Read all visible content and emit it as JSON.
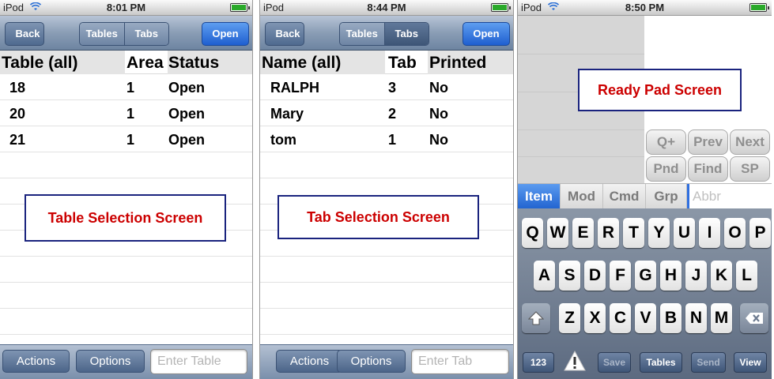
{
  "screen1": {
    "status": {
      "carrier": "iPod",
      "time": "8:01 PM"
    },
    "nav": {
      "back": "Back",
      "seg_left": "Tables",
      "seg_right": "Tabs",
      "open": "Open"
    },
    "headers": [
      "Table (all)",
      "Area",
      "Status"
    ],
    "rows": [
      {
        "c1": "18",
        "c2": "1",
        "c3": "Open"
      },
      {
        "c1": "20",
        "c2": "1",
        "c3": "Open"
      },
      {
        "c1": "21",
        "c2": "1",
        "c3": "Open"
      }
    ],
    "callout": "Table Selection Screen",
    "toolbar": {
      "actions": "Actions",
      "options": "Options",
      "input_placeholder": "Enter Table"
    }
  },
  "screen2": {
    "status": {
      "carrier": "iPod",
      "time": "8:44 PM"
    },
    "nav": {
      "back": "Back",
      "seg_left": "Tables",
      "seg_right": "Tabs",
      "open": "Open"
    },
    "headers": [
      "Name (all)",
      "Tab",
      "Printed"
    ],
    "rows": [
      {
        "c1": "RALPH",
        "c2": "3",
        "c3": "No"
      },
      {
        "c1": "Mary",
        "c2": "2",
        "c3": "No"
      },
      {
        "c1": "tom",
        "c2": "1",
        "c3": "No"
      }
    ],
    "callout": "Tab Selection Screen",
    "toolbar": {
      "actions": "Actions",
      "options": "Options",
      "input_placeholder": "Enter Tab"
    }
  },
  "screen3": {
    "status": {
      "carrier": "iPod",
      "time": "8:50 PM"
    },
    "callout": "Ready Pad Screen",
    "pad_buttons": [
      "Q+",
      "Prev",
      "Next",
      "Pnd",
      "Find",
      "SP"
    ],
    "tabs": [
      "Item",
      "Mod",
      "Cmd",
      "Grp"
    ],
    "abbr_placeholder": "Abbr",
    "keys_row1": [
      "Q",
      "W",
      "E",
      "R",
      "T",
      "Y",
      "U",
      "I",
      "O",
      "P"
    ],
    "keys_row2": [
      "A",
      "S",
      "D",
      "F",
      "G",
      "H",
      "J",
      "K",
      "L"
    ],
    "keys_row3": [
      "Z",
      "X",
      "C",
      "V",
      "B",
      "N",
      "M"
    ],
    "bottom": {
      "num": "123",
      "save": "Save",
      "tables": "Tables",
      "send": "Send",
      "view": "View"
    }
  },
  "colors": {
    "accent_blue": "#2163cf",
    "callout_text": "#cc0000",
    "callout_border": "#1a237e"
  },
  "icons": [
    "wifi-icon",
    "battery-icon",
    "shift-icon",
    "delete-icon",
    "warning-icon"
  ]
}
